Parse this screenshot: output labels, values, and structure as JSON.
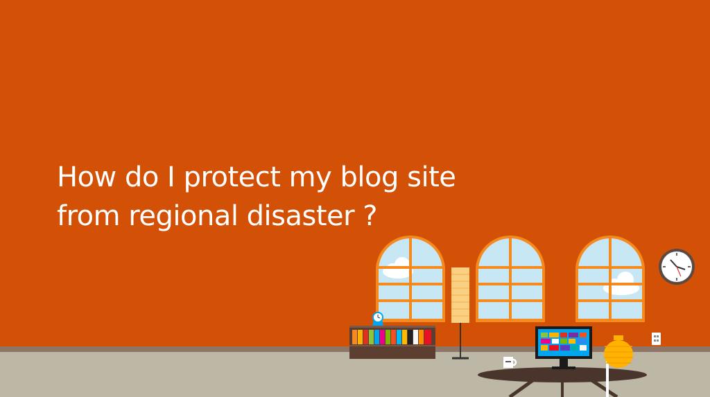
{
  "headline": {
    "line1": "How do I protect my blog site",
    "line2": "from regional disaster ?"
  },
  "colors": {
    "wall": "#d35106",
    "baseboard": "#8f7565",
    "floor": "#bdb7a6",
    "window_frame": "#f58a1f",
    "sky": "#c7e7f5",
    "cloud": "#ffffff",
    "lamp_shade": "#fad083",
    "shelf": "#5b3e2f",
    "table": "#4a352c",
    "vase": "#ffb300",
    "clock_face": "#ffffff"
  },
  "icons": [
    "arched-window-icon",
    "wall-clock-icon",
    "floor-lamp-icon",
    "bookshelf-icon",
    "desk-clock-icon",
    "monitor-icon",
    "coffee-mug-icon",
    "vase-icon",
    "power-outlet-icon"
  ]
}
